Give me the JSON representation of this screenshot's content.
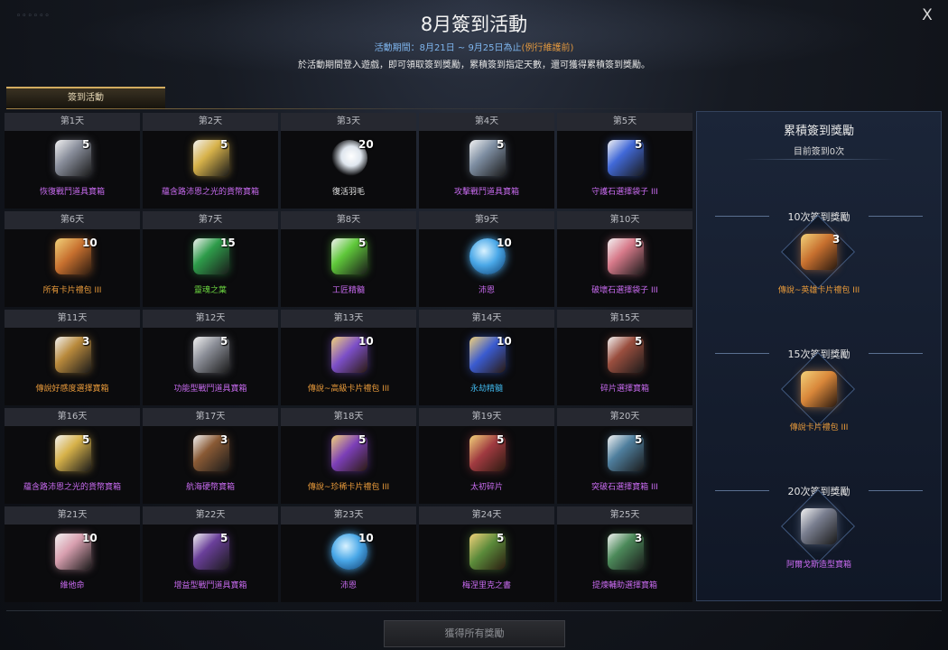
{
  "window": {
    "title": "8月簽到活動",
    "period_text": "活動期間：8月21日 ~ 9月25日為止",
    "period_note": "(例行維護前)",
    "description": "於活動期間登入遊戲，即可領取簽到獎勵，累積簽到指定天數，還可獲得累積簽到獎勵。",
    "close_label": "X",
    "corner_deco": "◦◦◦◦◦◦"
  },
  "tab": {
    "label": "簽到活動"
  },
  "days": [
    {
      "day": "第1天",
      "qty": "5",
      "name": "恢復戰鬥道具寶箱",
      "color": "#c86bf0",
      "icon": "chest-icon",
      "icon_color": "#8a8f9c"
    },
    {
      "day": "第2天",
      "qty": "5",
      "name": "蘊含路沛恩之光的貨幣寶箱",
      "color": "#c86bf0",
      "icon": "chest-icon",
      "icon_color": "#d7b24a"
    },
    {
      "day": "第3天",
      "qty": "20",
      "name": "復活羽毛",
      "color": "#e6e6e6",
      "icon": "feather-icon",
      "icon_color": "#dfe6ee"
    },
    {
      "day": "第4天",
      "qty": "5",
      "name": "攻擊戰鬥道具寶箱",
      "color": "#c86bf0",
      "icon": "chest-icon",
      "icon_color": "#7f8fa3"
    },
    {
      "day": "第5天",
      "qty": "5",
      "name": "守護石選擇袋子 III",
      "color": "#c86bf0",
      "icon": "pouch-icon",
      "icon_color": "#4169d8"
    },
    {
      "day": "第6天",
      "qty": "10",
      "name": "所有卡片禮包 III",
      "color": "#e89a3a",
      "icon": "card-pack-icon",
      "icon_color": "#c7702f"
    },
    {
      "day": "第7天",
      "qty": "15",
      "name": "靈魂之葉",
      "color": "#6ad33f",
      "icon": "leaf-icon",
      "icon_color": "#2e9c4a"
    },
    {
      "day": "第8天",
      "qty": "5",
      "name": "工匠精髓",
      "color": "#c86bf0",
      "icon": "potion-icon",
      "icon_color": "#5fc83a"
    },
    {
      "day": "第9天",
      "qty": "10",
      "name": "沛恩",
      "color": "#c86bf0",
      "icon": "coin-icon",
      "icon_color": "#4aa8e8"
    },
    {
      "day": "第10天",
      "qty": "5",
      "name": "破壞石選擇袋子 III",
      "color": "#c86bf0",
      "icon": "pouch-icon",
      "icon_color": "#d77a8a"
    },
    {
      "day": "第11天",
      "qty": "3",
      "name": "傳說好感度選擇寶箱",
      "color": "#e89a3a",
      "icon": "chest-icon",
      "icon_color": "#b98a3c"
    },
    {
      "day": "第12天",
      "qty": "5",
      "name": "功能型戰鬥道具寶箱",
      "color": "#c86bf0",
      "icon": "chest-icon",
      "icon_color": "#8c8f98"
    },
    {
      "day": "第13天",
      "qty": "10",
      "name": "傳說~高級卡片禮包 III",
      "color": "#e89a3a",
      "icon": "card-pack-icon",
      "icon_color": "#7c4fc8"
    },
    {
      "day": "第14天",
      "qty": "10",
      "name": "永劫精髓",
      "color": "#3fb4e8",
      "icon": "card-icon",
      "icon_color": "#3a5bd0"
    },
    {
      "day": "第15天",
      "qty": "5",
      "name": "碎片選擇寶箱",
      "color": "#c86bf0",
      "icon": "chest-icon",
      "icon_color": "#9a4e3e"
    },
    {
      "day": "第16天",
      "qty": "5",
      "name": "蘊含路沛恩之光的貨幣寶箱",
      "color": "#c86bf0",
      "icon": "chest-icon",
      "icon_color": "#d7b24a"
    },
    {
      "day": "第17天",
      "qty": "3",
      "name": "航海硬幣寶箱",
      "color": "#c86bf0",
      "icon": "chest-icon",
      "icon_color": "#8a5a35"
    },
    {
      "day": "第18天",
      "qty": "5",
      "name": "傳說~珍稀卡片禮包 III",
      "color": "#e89a3a",
      "icon": "card-pack-icon",
      "icon_color": "#7c3fb8"
    },
    {
      "day": "第19天",
      "qty": "5",
      "name": "太初碎片",
      "color": "#c86bf0",
      "icon": "card-icon",
      "icon_color": "#a03a40"
    },
    {
      "day": "第20天",
      "qty": "5",
      "name": "突破石選擇寶箱 III",
      "color": "#c86bf0",
      "icon": "chest-icon",
      "icon_color": "#4f7f9e"
    },
    {
      "day": "第21天",
      "qty": "10",
      "name": "維他命",
      "color": "#c86bf0",
      "icon": "can-icon",
      "icon_color": "#d9a0b0"
    },
    {
      "day": "第22天",
      "qty": "5",
      "name": "增益型戰鬥道具寶箱",
      "color": "#c86bf0",
      "icon": "chest-icon",
      "icon_color": "#6a3f9a"
    },
    {
      "day": "第23天",
      "qty": "10",
      "name": "沛恩",
      "color": "#c86bf0",
      "icon": "coin-icon",
      "icon_color": "#4aa8e8"
    },
    {
      "day": "第24天",
      "qty": "5",
      "name": "梅涅里克之書",
      "color": "#c86bf0",
      "icon": "book-icon",
      "icon_color": "#5a8a3a"
    },
    {
      "day": "第25天",
      "qty": "3",
      "name": "提煉輔助選擇寶箱",
      "color": "#c86bf0",
      "icon": "chest-icon",
      "icon_color": "#4c8a5a"
    }
  ],
  "sidebar": {
    "title": "累積簽到獎勵",
    "subtitle": "目前簽到0次",
    "rewards": [
      {
        "label": "10次簽到獎勵",
        "qty": "3",
        "name": "傳說~英雄卡片禮包 III",
        "color": "#e89a3a",
        "icon": "card-pack-icon",
        "icon_color": "#c7702f"
      },
      {
        "label": "15次簽到獎勵",
        "qty": "",
        "name": "傳說卡片禮包 III",
        "color": "#e89a3a",
        "icon": "book-icon",
        "icon_color": "#d9873a"
      },
      {
        "label": "20次簽到獎勵",
        "qty": "",
        "name": "阿爾戈斯造型寶箱",
        "color": "#c86bf0",
        "icon": "chest-icon",
        "icon_color": "#7a7f90"
      }
    ]
  },
  "footer": {
    "claim_all_label": "獲得所有獎勵"
  }
}
